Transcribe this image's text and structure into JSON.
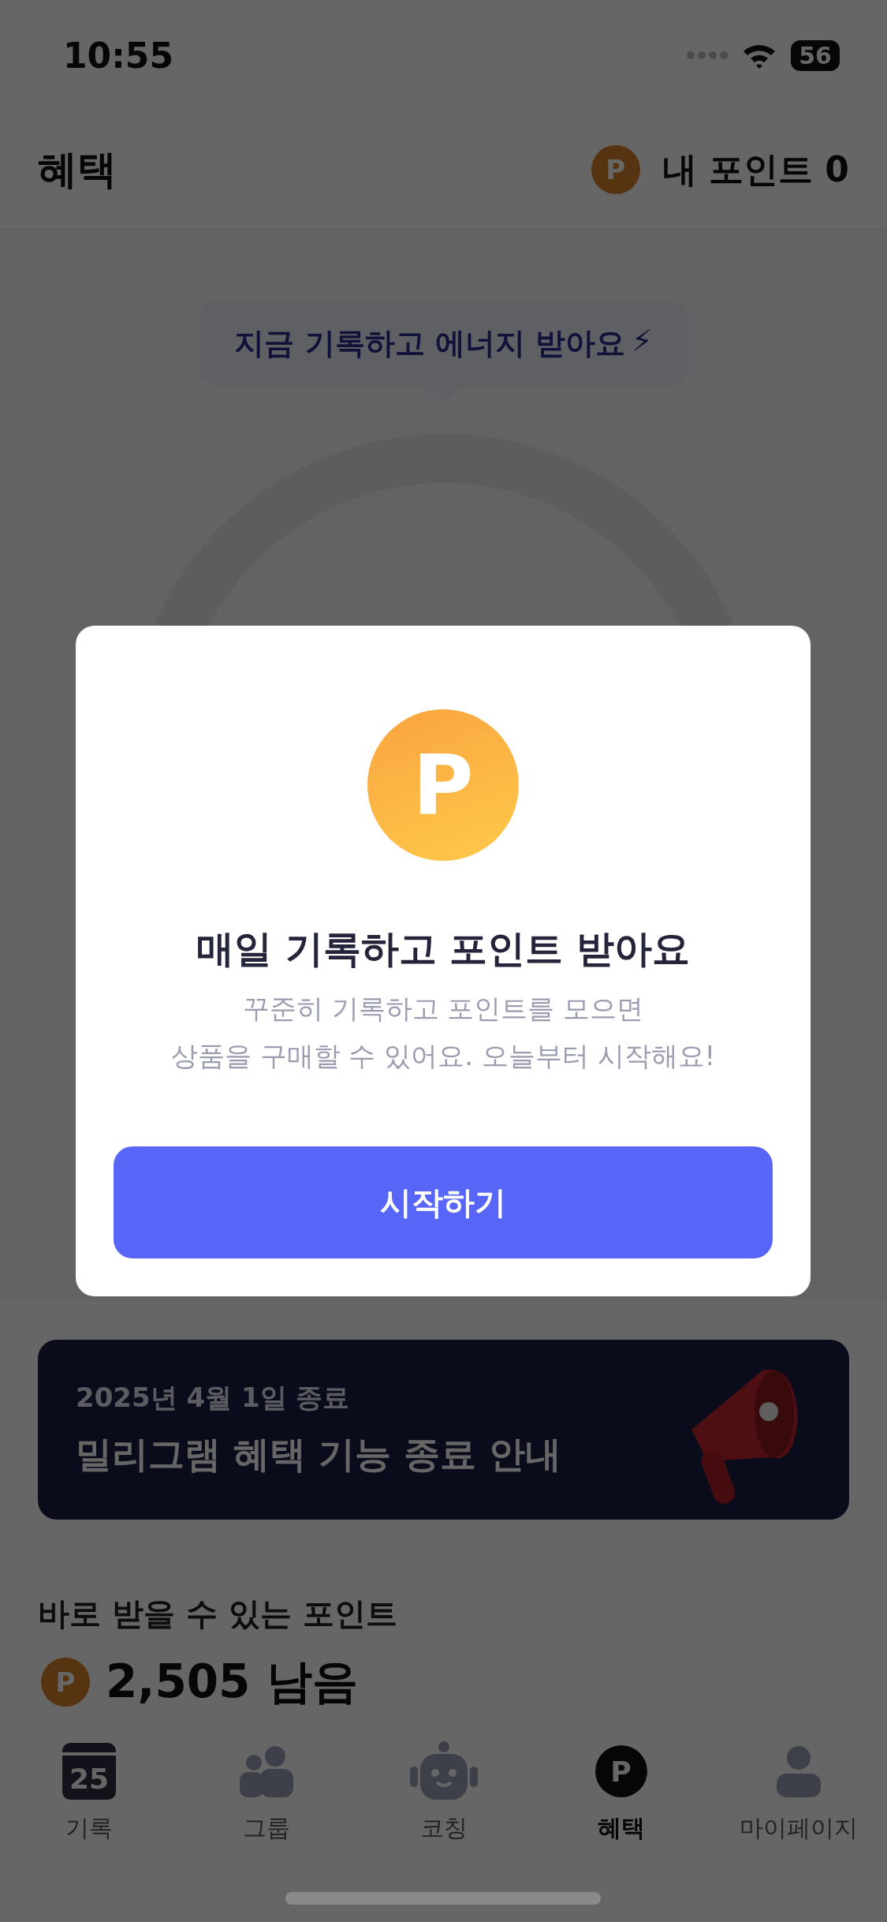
{
  "status_bar": {
    "time": "10:55",
    "battery": "56"
  },
  "header": {
    "title": "혜택",
    "coin": "P",
    "points": "내 포인트 0"
  },
  "tooltip": {
    "text": "지금 기록하고 에너지 받아요",
    "emoji": "⚡"
  },
  "modal": {
    "coin": "P",
    "title": "매일 기록하고 포인트 받아요",
    "body_lines": [
      "꾸준히 기록하고 포인트를 모으면",
      "상품을 구매할 수 있어요. 오늘부터 시작해요!"
    ],
    "button": "시작하기"
  },
  "banner": {
    "date": "2025년 4월 1일 종료",
    "title": "밀리그램 혜택 기능 종료 안내"
  },
  "points": {
    "title": "바로 받을 수 있는 포인트",
    "coin": "P",
    "amount": "2,505 남음"
  },
  "tabs": [
    {
      "kind": "calendar",
      "icon_text": "25",
      "label": "기록",
      "selected": false
    },
    {
      "kind": "group",
      "label": "그룹",
      "selected": false
    },
    {
      "kind": "robot",
      "label": "코칭",
      "selected": false
    },
    {
      "kind": "coin",
      "icon_text": "P",
      "label": "혜택",
      "selected": true
    },
    {
      "kind": "person",
      "label": "마이페이지",
      "selected": false
    }
  ]
}
